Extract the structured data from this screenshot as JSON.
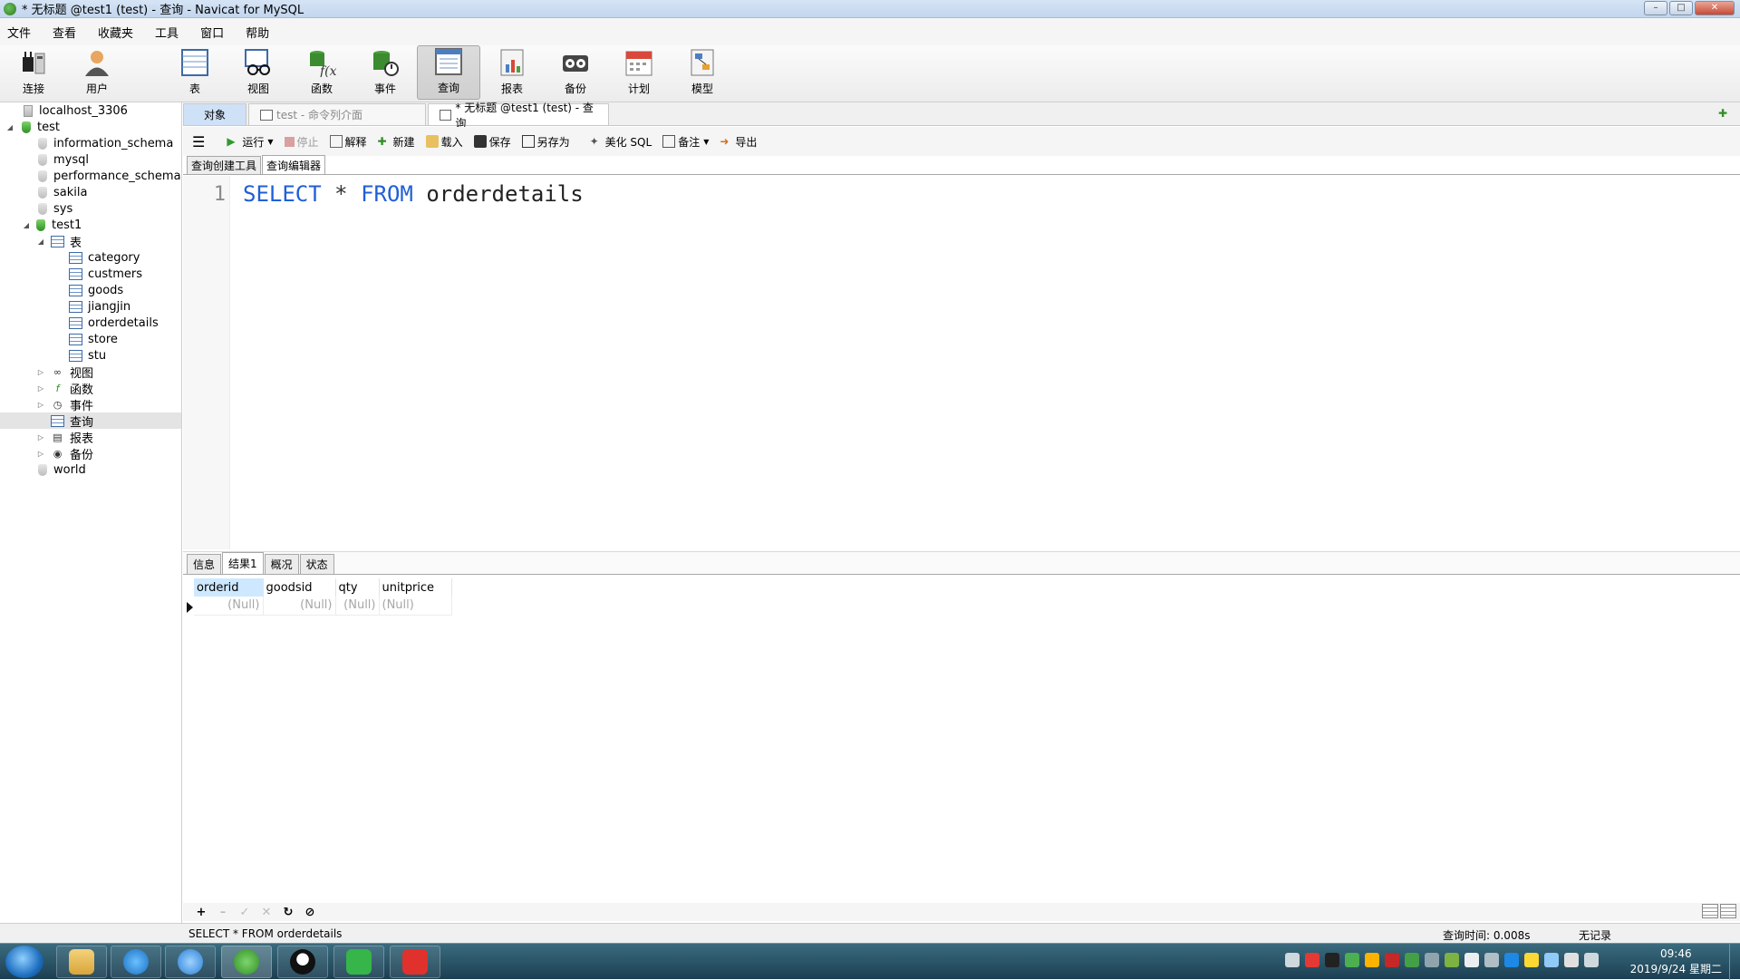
{
  "window": {
    "title": "* 无标题 @test1 (test) - 查询 - Navicat for MySQL"
  },
  "menu": [
    "文件",
    "查看",
    "收藏夹",
    "工具",
    "窗口",
    "帮助"
  ],
  "ribbon": {
    "connect": "连接",
    "user": "用户",
    "table": "表",
    "view": "视图",
    "function": "函数",
    "event": "事件",
    "query": "查询",
    "report": "报表",
    "backup": "备份",
    "schedule": "计划",
    "model": "模型"
  },
  "tree": {
    "connection": "localhost_3306",
    "databases": [
      "test",
      "information_schema",
      "mysql",
      "performance_schema",
      "sakila",
      "sys",
      "test1"
    ],
    "group_tables": "表",
    "tables": [
      "category",
      "custmers",
      "goods",
      "jiangjin",
      "orderdetails",
      "store",
      "stu"
    ],
    "group_views": "视图",
    "group_functions": "函数",
    "group_events": "事件",
    "group_queries": "查询",
    "group_reports": "报表",
    "group_backups": "备份",
    "world": "world"
  },
  "tabs": {
    "objects": "对象",
    "console": "test - 命令列介面",
    "query": "* 无标题 @test1 (test) - 查询"
  },
  "query_toolbar": {
    "run": "运行",
    "stop": "停止",
    "explain": "解释",
    "new": "新建",
    "load": "载入",
    "save": "保存",
    "save_as": "另存为",
    "beautify": "美化 SQL",
    "comment": "备注",
    "export": "导出"
  },
  "subtabs": {
    "builder": "查询创建工具",
    "editor": "查询编辑器"
  },
  "editor": {
    "line": "1",
    "kw_select": "SELECT",
    "star": "*",
    "kw_from": "FROM",
    "table": "orderdetails"
  },
  "result_tabs": {
    "info": "信息",
    "result1": "结果1",
    "profile": "概况",
    "status": "状态"
  },
  "grid": {
    "columns": [
      "orderid",
      "goodsid",
      "qty",
      "unitprice"
    ],
    "row": [
      "(Null)",
      "(Null)",
      "(Null)",
      "(Null)"
    ]
  },
  "statusbar": {
    "sql": "SELECT * FROM orderdetails",
    "query_time": "查询时间: 0.008s",
    "records": "无记录"
  },
  "taskbar": {
    "time": "09:46",
    "date": "2019/9/24 星期二"
  }
}
